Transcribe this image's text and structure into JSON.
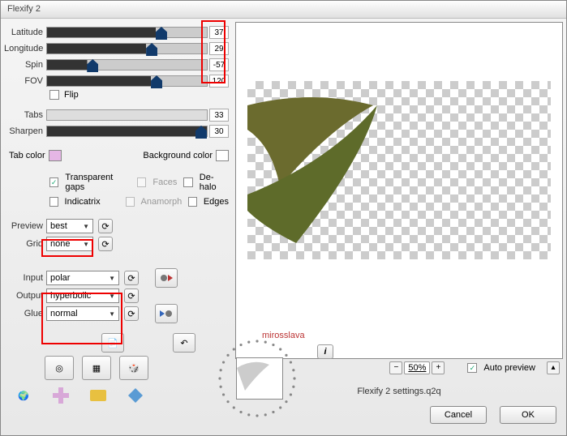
{
  "title": "Flexify 2",
  "sliders": {
    "latitude": {
      "label": "Latitude",
      "value": "37",
      "pos": 68
    },
    "longitude": {
      "label": "Longitude",
      "value": "29",
      "pos": 62
    },
    "spin": {
      "label": "Spin",
      "value": "-57",
      "pos": 25
    },
    "fov": {
      "label": "FOV",
      "value": "120",
      "pos": 65
    },
    "tabs": {
      "label": "Tabs",
      "value": "33"
    },
    "sharpen": {
      "label": "Sharpen",
      "value": "30",
      "pos": 100
    }
  },
  "flip": "Flip",
  "color": {
    "tab_label": "Tab color",
    "bg_label": "Background color",
    "tab_hex": "#e5b6e5",
    "bg_hex": "#ffffff"
  },
  "checks": {
    "transparent": "Transparent gaps",
    "faces": "Faces",
    "dehalo": "De-halo",
    "indicatrix": "Indicatrix",
    "anamorph": "Anamorph",
    "edges": "Edges"
  },
  "preview": {
    "label": "Preview",
    "value": "best"
  },
  "grid": {
    "label": "Grid",
    "value": "none"
  },
  "input": {
    "label": "Input",
    "value": "polar"
  },
  "output": {
    "label": "Output",
    "value": "hyperbolic"
  },
  "glue": {
    "label": "Glue",
    "value": "normal"
  },
  "credit": "mirosslava",
  "zoom": "50%",
  "auto_preview": "Auto preview",
  "settings_file": "Flexify 2 settings.q2q",
  "buttons": {
    "cancel": "Cancel",
    "ok": "OK"
  }
}
